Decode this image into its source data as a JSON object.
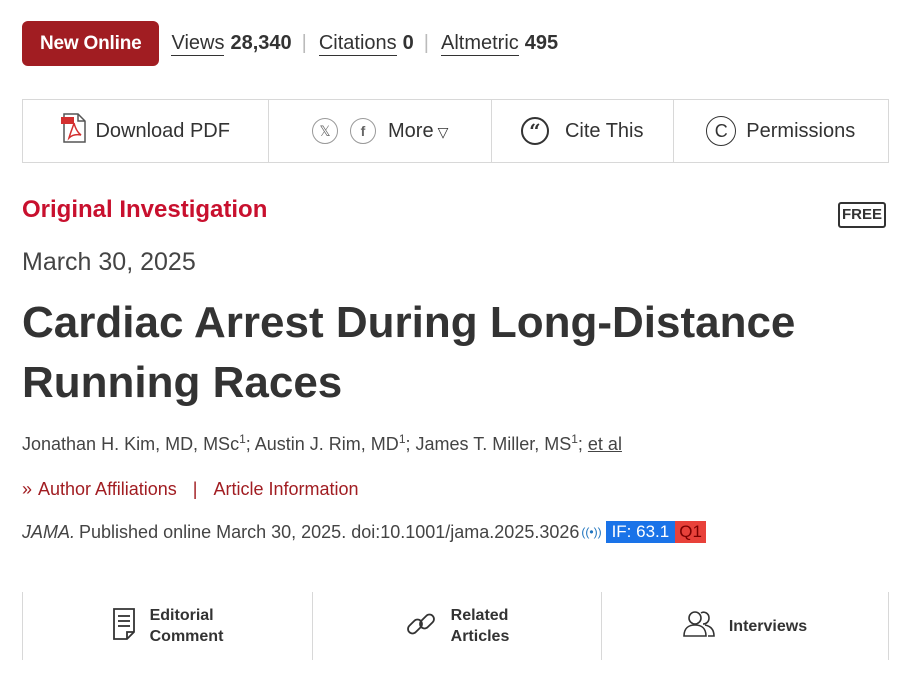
{
  "metrics": {
    "badge": "New Online",
    "views_label": "Views",
    "views_value": "28,340",
    "citations_label": "Citations",
    "citations_value": "0",
    "altmetric_label": "Altmetric",
    "altmetric_value": "495"
  },
  "toolbar": {
    "download_pdf": "Download PDF",
    "x_icon": "𝕏",
    "facebook_icon": "f",
    "more": "More",
    "cite_this": "Cite This",
    "permissions": "Permissions"
  },
  "article": {
    "category": "Original Investigation",
    "free_badge": "FREE",
    "date": "March 30, 2025",
    "title": "Cardiac Arrest During Long-Distance Running Races",
    "authors": [
      {
        "name": "Jonathan H. Kim, MD, MSc",
        "aff": "1"
      },
      {
        "name": "Austin J. Rim, MD",
        "aff": "1"
      },
      {
        "name": "James T. Miller, MS",
        "aff": "1"
      }
    ],
    "et_al": "et al",
    "author_affiliations": "Author Affiliations",
    "article_information": "Article Information",
    "journal": "JAMA.",
    "citation_text": "Published online March 30, 2025. doi:10.1001/jama.2025.3026",
    "impact_factor": "IF: 63.1",
    "quartile": "Q1"
  },
  "related": {
    "editorial_line1": "Editorial",
    "editorial_line2": "Comment",
    "related_line1": "Related",
    "related_line2": "Articles",
    "interviews": "Interviews"
  },
  "colors": {
    "brand_red": "#a11d22",
    "category_red": "#c8102e",
    "if_blue": "#1a73e8",
    "q_red": "#e8413a"
  }
}
